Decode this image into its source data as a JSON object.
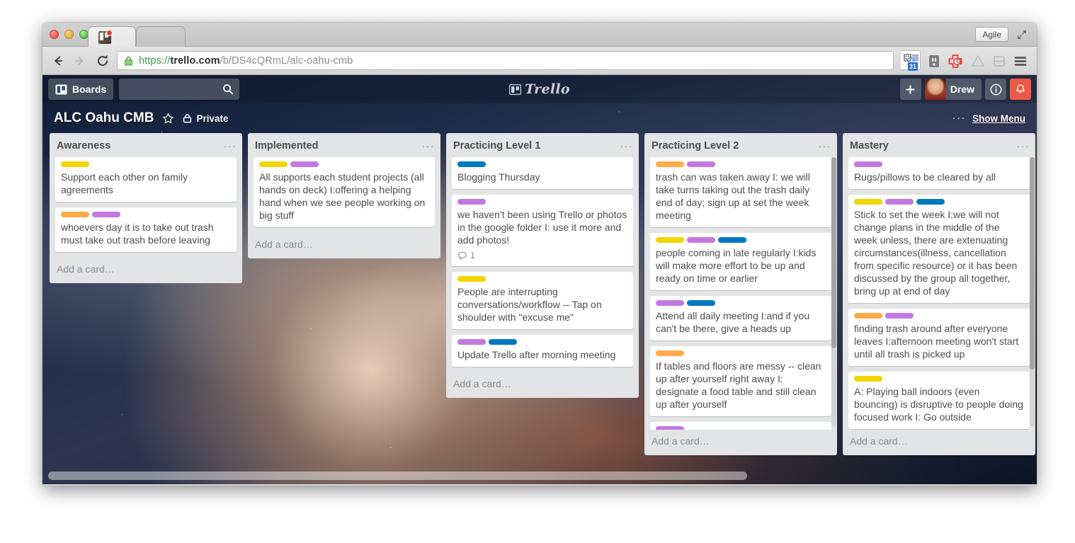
{
  "browser": {
    "window_buttons": [
      "close",
      "minimize",
      "zoom"
    ],
    "tab_title": "",
    "agile_label": "Agile",
    "url": {
      "scheme": "https://",
      "host": "trello.com",
      "path": "/b/DS4cQRmL/alc-oahu-cmb",
      "full": "https://trello.com/b/DS4cQRmL/alc-oahu-cmb"
    },
    "extensions": [
      {
        "name": "calendar-extension-icon",
        "badge": "31"
      },
      {
        "name": "outlet-extension-icon",
        "badge": ""
      },
      {
        "name": "red-cross-clock-extension-icon",
        "badge": ""
      },
      {
        "name": "google-drive-extension-icon",
        "badge": ""
      },
      {
        "name": "split-view-extension-icon",
        "badge": ""
      }
    ]
  },
  "trello_header": {
    "boards_label": "Boards",
    "search_placeholder": "",
    "search_value": "",
    "logo_text": "Trello",
    "add_label": "+",
    "member_name": "Drew",
    "info_label": "i"
  },
  "board": {
    "title": "ALC Oahu CMB",
    "visibility": "Private",
    "menu_dots": "···",
    "show_menu_label": "Show Menu",
    "add_card_label": "Add a card…"
  },
  "label_colors": {
    "yellow": "#f2d600",
    "purple": "#c377e0",
    "blue": "#0079bf",
    "orange": "#ffab4a",
    "green": "#61bd4f",
    "red": "#eb5a46"
  },
  "lists": [
    {
      "title": "Awareness",
      "scrollbar": false,
      "cards": [
        {
          "labels": [
            "yellow"
          ],
          "title": "Support each other on family agreements",
          "comments": ""
        },
        {
          "labels": [
            "orange",
            "purple"
          ],
          "title": "whoevers day it is to take out trash must take out trash before leaving",
          "comments": ""
        }
      ]
    },
    {
      "title": "Implemented",
      "scrollbar": false,
      "cards": [
        {
          "labels": [
            "yellow",
            "purple"
          ],
          "title": "All supports each student projects (all hands on deck) I:offering a helping hand when we see people working on big stuff",
          "comments": ""
        }
      ]
    },
    {
      "title": "Practicing Level 1",
      "scrollbar": false,
      "cards": [
        {
          "labels": [
            "blue"
          ],
          "title": "Blogging Thursday",
          "comments": ""
        },
        {
          "labels": [
            "purple"
          ],
          "title": "we haven't been using Trello or photos in the google folder I: use it more and add photos!",
          "comments": "1"
        },
        {
          "labels": [
            "yellow"
          ],
          "title": "People are interrupting conversations/workflow -- Tap on shoulder with \"excuse me\"",
          "comments": ""
        },
        {
          "labels": [
            "purple",
            "blue"
          ],
          "title": "Update Trello after morning meeting",
          "comments": ""
        }
      ]
    },
    {
      "title": "Practicing Level 2",
      "scrollbar": true,
      "cards": [
        {
          "labels": [
            "orange",
            "purple"
          ],
          "title": "trash can was taken away I: we will take turns taking out the trash daily end of day; sign up at set the week meeting",
          "comments": ""
        },
        {
          "labels": [
            "yellow",
            "purple",
            "blue"
          ],
          "title": "people coming in late regularly I:kids will make more effort to be up and ready on time or earlier",
          "comments": ""
        },
        {
          "labels": [
            "purple",
            "blue"
          ],
          "title": "Attend all daily meeting I:and if you can't be there, give a heads up",
          "comments": ""
        },
        {
          "labels": [
            "orange"
          ],
          "title": "If tables and floors are messy -- clean up after yourself right away I: designate a food table and still clean up after yourself",
          "comments": ""
        },
        {
          "labels": [
            "purple"
          ],
          "title": "",
          "comments": ""
        }
      ]
    },
    {
      "title": "Mastery",
      "scrollbar": true,
      "cards": [
        {
          "labels": [
            "purple"
          ],
          "title": "Rugs/pillows to be cleared by all",
          "comments": ""
        },
        {
          "labels": [
            "yellow",
            "purple",
            "blue"
          ],
          "title": "Stick to set the week I:we will not change plans in the middle of the week unless, there are extenuating circumstances(illness, cancellation from specific resource) or it has been discussed by the group all together, bring up at end of day",
          "comments": ""
        },
        {
          "labels": [
            "orange",
            "purple"
          ],
          "title": "finding trash around after everyone leaves I:afternoon meeting won't start until all trash is picked up",
          "comments": ""
        },
        {
          "labels": [
            "yellow"
          ],
          "title": "A: Playing ball indoors (even bouncing) is disruptive to people doing focused work I: Go outside",
          "comments": ""
        }
      ]
    }
  ]
}
